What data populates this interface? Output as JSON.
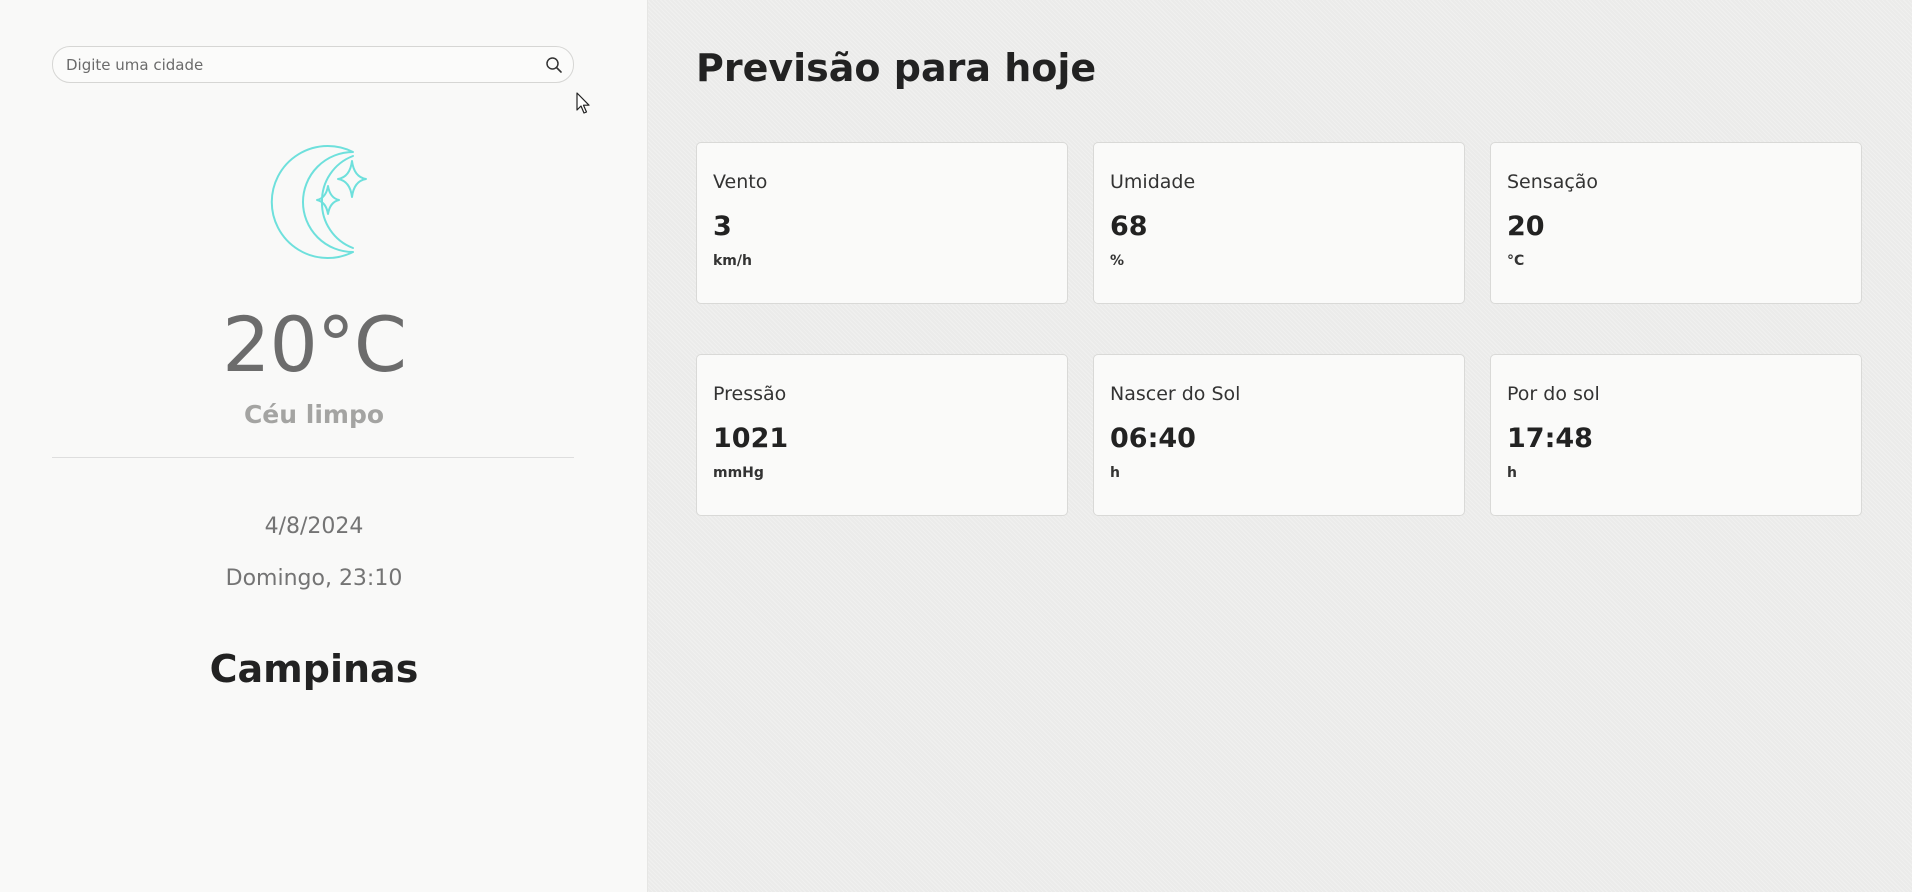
{
  "search": {
    "placeholder": "Digite uma cidade",
    "icon": "search-icon"
  },
  "current": {
    "icon": "moon-stars-icon",
    "icon_color": "#6ee0dc",
    "temperature": "20°C",
    "condition": "Céu limpo",
    "date": "4/8/2024",
    "day_time": "Domingo, 23:10",
    "city": "Campinas"
  },
  "main": {
    "title": "Previsão para hoje",
    "cards": [
      {
        "label": "Vento",
        "value": "3",
        "unit": "km/h"
      },
      {
        "label": "Umidade",
        "value": "68",
        "unit": "%"
      },
      {
        "label": "Sensação",
        "value": "20",
        "unit": "°C"
      },
      {
        "label": "Pressão",
        "value": "1021",
        "unit": "mmHg"
      },
      {
        "label": "Nascer do Sol",
        "value": "06:40",
        "unit": "h"
      },
      {
        "label": "Por do sol",
        "value": "17:48",
        "unit": "h"
      }
    ]
  }
}
